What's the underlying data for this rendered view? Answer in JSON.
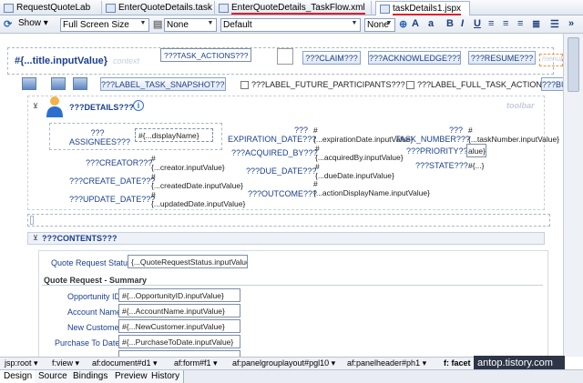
{
  "tabs": [
    {
      "label": "RequestQuoteLab"
    },
    {
      "label": "EnterQuoteDetails.task"
    },
    {
      "label": "EnterQuoteDetails_TaskFlow.xml"
    },
    {
      "label": "taskDetails1.jspx"
    }
  ],
  "toolbar": {
    "show_label": "Show",
    "view_mode": "Full Screen Size",
    "style_class": "None",
    "style": "Default",
    "font": "None"
  },
  "header": {
    "title_binding": "#{...title.inputValue}",
    "context_label": "context",
    "task_actions": "???TASK_ACTIONS???",
    "claim": "???CLAIM???",
    "acknowledge": "???ACKNOWLEDGE???",
    "resume": "???RESUME???",
    "menu_label": "menuBa"
  },
  "toolbar_row": {
    "snapshot": "???LABEL_TASK_SNAPSHOT???",
    "future_participants": "???LABEL_FUTURE_PARTICIPANTS???",
    "full_actions": "???LABEL_FULL_TASK_ACTIONS???",
    "more": "???BUT"
  },
  "details": {
    "title": "???DETAILS???",
    "toolbar_label": "toolbar",
    "assignees_label": "??? ASSIGNEES???",
    "assignees_value": "#{...displayName}",
    "creator_label": "???CREATOR???",
    "creator_value": "#{...creator.inputValue}",
    "create_date_label": "???CREATE_DATE???",
    "create_date_value": "#{...createdDate.inputValue}",
    "update_date_label": "???UPDATE_DATE???",
    "update_date_value": "#{...updatedDate.inputValue}",
    "expiration_label": "??? EXPIRATION_DATE???",
    "expiration_value": "#{...expirationDate.inputValue}",
    "acquired_label": "???ACQUIRED_BY???",
    "acquired_value": "#{...acquiredBy.inputValue}",
    "due_label": "???DUE_DATE???",
    "due_value": "#{...dueDate.inputValue}",
    "outcome_label": "???OUTCOME???",
    "outcome_value": "#{...actionDisplayName.inputValue}",
    "task_number_label": "??? TASK_NUMBER???",
    "task_number_value": "#{...taskNumber.inputValue}",
    "priority_label": "???PRIORITY???",
    "priority_value": "alue}",
    "state_label": "???STATE???",
    "state_value": "#{...}"
  },
  "contents": {
    "title": "???CONTENTS???",
    "status_label": "Quote Request Status",
    "status_value": "{...QuoteRequestStatus.inputValue}",
    "summary_title": "Quote Request - Summary",
    "fields": [
      {
        "label": "Opportunity ID",
        "value": "#{...OpportunityID.inputValue}"
      },
      {
        "label": "Account Name",
        "value": "#{...AccountName.inputValue}"
      },
      {
        "label": "New Customer",
        "value": "#{...NewCustomer.inputValue}"
      },
      {
        "label": "Purchase To Date",
        "value": "#{...PurchaseToDate.inputValue}"
      }
    ]
  },
  "breadcrumb": [
    "jsp:root",
    "f:view",
    "af:document#d1",
    "af:form#f1",
    "af:panelgrouplayout#pgl10",
    "af:panelheader#ph1",
    "f: facet"
  ],
  "watermark": "antop.tistory.com",
  "bottom_tabs": [
    "Design",
    "Source",
    "Bindings",
    "Preview",
    "History"
  ]
}
